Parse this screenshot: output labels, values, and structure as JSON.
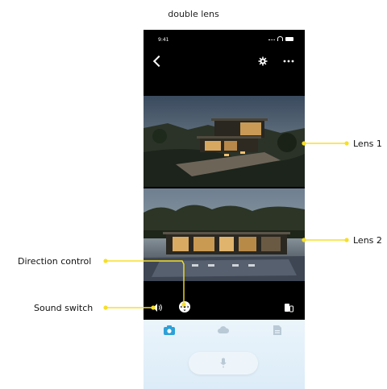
{
  "caption": "double lens",
  "status_bar": {
    "time": "9:41"
  },
  "header": {
    "back_icon": "chevron-left-icon",
    "settings_icon": "gear-icon",
    "more_icon": "ellipsis-icon"
  },
  "lenses": [
    {
      "label": "Lens 1"
    },
    {
      "label": "Lens 2"
    }
  ],
  "controls": {
    "direction_label": "Direction control",
    "sound_label": "Sound switch",
    "split_icon": "split-screen-icon"
  },
  "tabs": [
    {
      "icon": "live-camera-icon",
      "active": true
    },
    {
      "icon": "cloud-icon",
      "active": false
    },
    {
      "icon": "record-file-icon",
      "active": false
    }
  ],
  "talk": {
    "icon": "microphone-icon"
  },
  "colors": {
    "leader_line": "#f5df2a",
    "accent": "#2ea0d8",
    "tab_inactive": "#b9c9d6",
    "bottom_panel": "#e3eff9"
  }
}
